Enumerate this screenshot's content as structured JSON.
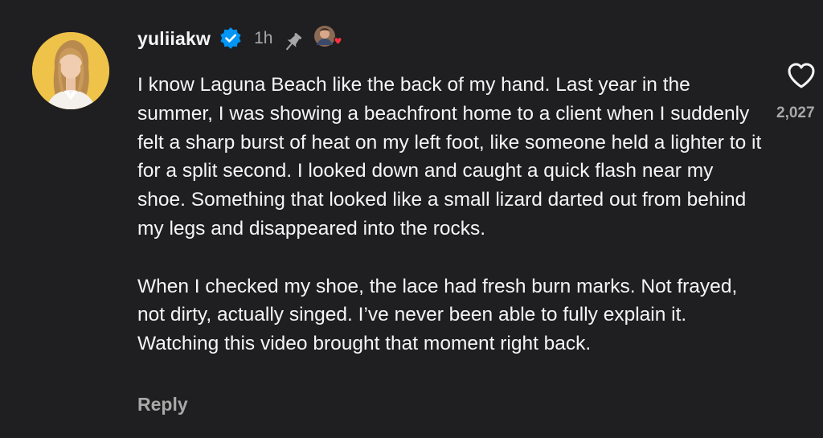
{
  "comment": {
    "username": "yuliiakw",
    "timestamp": "1h",
    "paragraphs": [
      "I know Laguna Beach like the back of my hand. Last year in the summer, I was showing a beachfront home to a client when I suddenly felt a sharp burst of heat on my left foot, like someone held a lighter to it for a split second. I looked down and caught a quick flash near my shoe. Something that looked like a small lizard darted out from behind my legs and disappeared into the rocks.",
      "When I checked my shoe, the lace had fresh burn marks. Not frayed, not dirty, actually singed. I’ve never been able to fully explain it. Watching this video brought that moment right back."
    ],
    "reply_label": "Reply",
    "like_count": "2,027",
    "icons": {
      "verified": "verified-badge-icon",
      "pin": "pin-icon",
      "creator_like": "creator-liked-icon",
      "like": "heart-icon"
    }
  },
  "colors": {
    "background": "#1f1f21",
    "text": "#f5f5f5",
    "muted": "#a8a8a8",
    "verified": "#0095f6",
    "avatar_bg": "#efc24a",
    "creator_heart": "#ff3040"
  }
}
